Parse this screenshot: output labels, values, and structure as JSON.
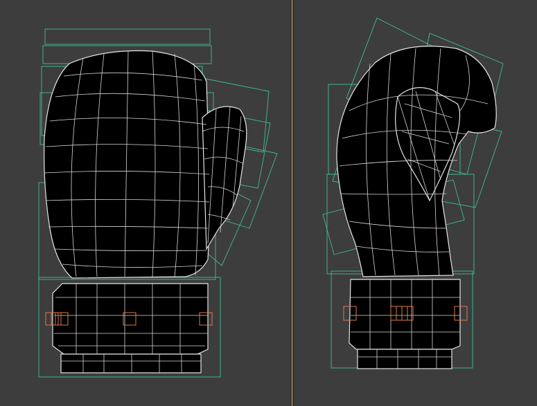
{
  "viewports": [
    {
      "id": "left",
      "label": ""
    },
    {
      "id": "right",
      "label": ""
    }
  ],
  "colors": {
    "background": "#3d3d3d",
    "mesh_fill": "#000000",
    "wireframe": "#e6e6e6",
    "bounding_box": "#3fbf8f",
    "bone": "#e07a4a",
    "divider_accent": "#c8b060"
  }
}
